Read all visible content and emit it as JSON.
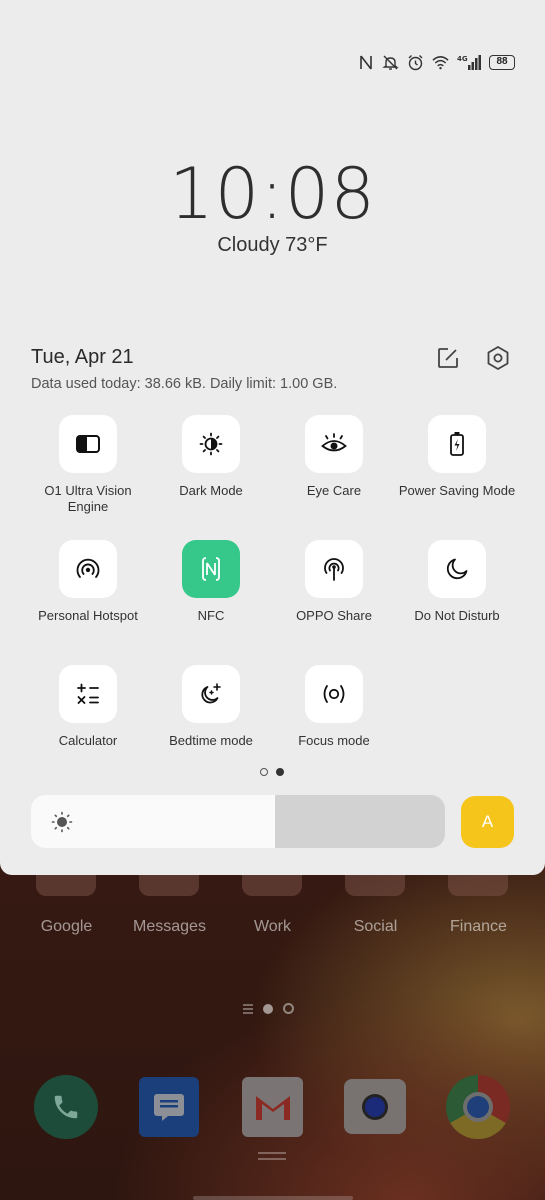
{
  "status_bar": {
    "icons": [
      "nfc-icon",
      "silent-icon",
      "alarm-icon",
      "wifi-icon",
      "4g-signal-icon"
    ],
    "network": "4G",
    "battery": "88"
  },
  "lock": {
    "time": "10:08",
    "weather": "Cloudy 73°F"
  },
  "header": {
    "date": "Tue, Apr 21",
    "data_usage": "Data used today: 38.66 kB. Daily limit: 1.00 GB."
  },
  "tiles": [
    {
      "label": "O1 Ultra Vision Engine",
      "icon": "vision-engine-icon",
      "active": false
    },
    {
      "label": "Dark Mode",
      "icon": "dark-mode-icon",
      "active": false
    },
    {
      "label": "Eye Care",
      "icon": "eye-icon",
      "active": false
    },
    {
      "label": "Power Saving Mode",
      "icon": "battery-saver-icon",
      "active": false
    },
    {
      "label": "Personal Hotspot",
      "icon": "hotspot-icon",
      "active": false
    },
    {
      "label": "NFC",
      "icon": "nfc-icon",
      "active": true
    },
    {
      "label": "OPPO Share",
      "icon": "share-icon",
      "active": false
    },
    {
      "label": "Do Not Disturb",
      "icon": "moon-icon",
      "active": false
    },
    {
      "label": "Calculator",
      "icon": "calculator-icon",
      "active": false
    },
    {
      "label": "Bedtime mode",
      "icon": "bedtime-icon",
      "active": false
    },
    {
      "label": "Focus mode",
      "icon": "focus-icon",
      "active": false
    }
  ],
  "pager": {
    "pages": 2,
    "current": 2
  },
  "brightness": {
    "level": 0.59,
    "auto_label": "A"
  },
  "colors": {
    "accent_active": "#35c88a",
    "auto_brightness": "#f6c51b"
  },
  "home": {
    "folders": [
      "Google",
      "Messages",
      "Work",
      "Social",
      "Finance"
    ],
    "dock": [
      "phone-icon",
      "messages-icon",
      "gmail-icon",
      "camera-icon",
      "chrome-icon"
    ]
  }
}
